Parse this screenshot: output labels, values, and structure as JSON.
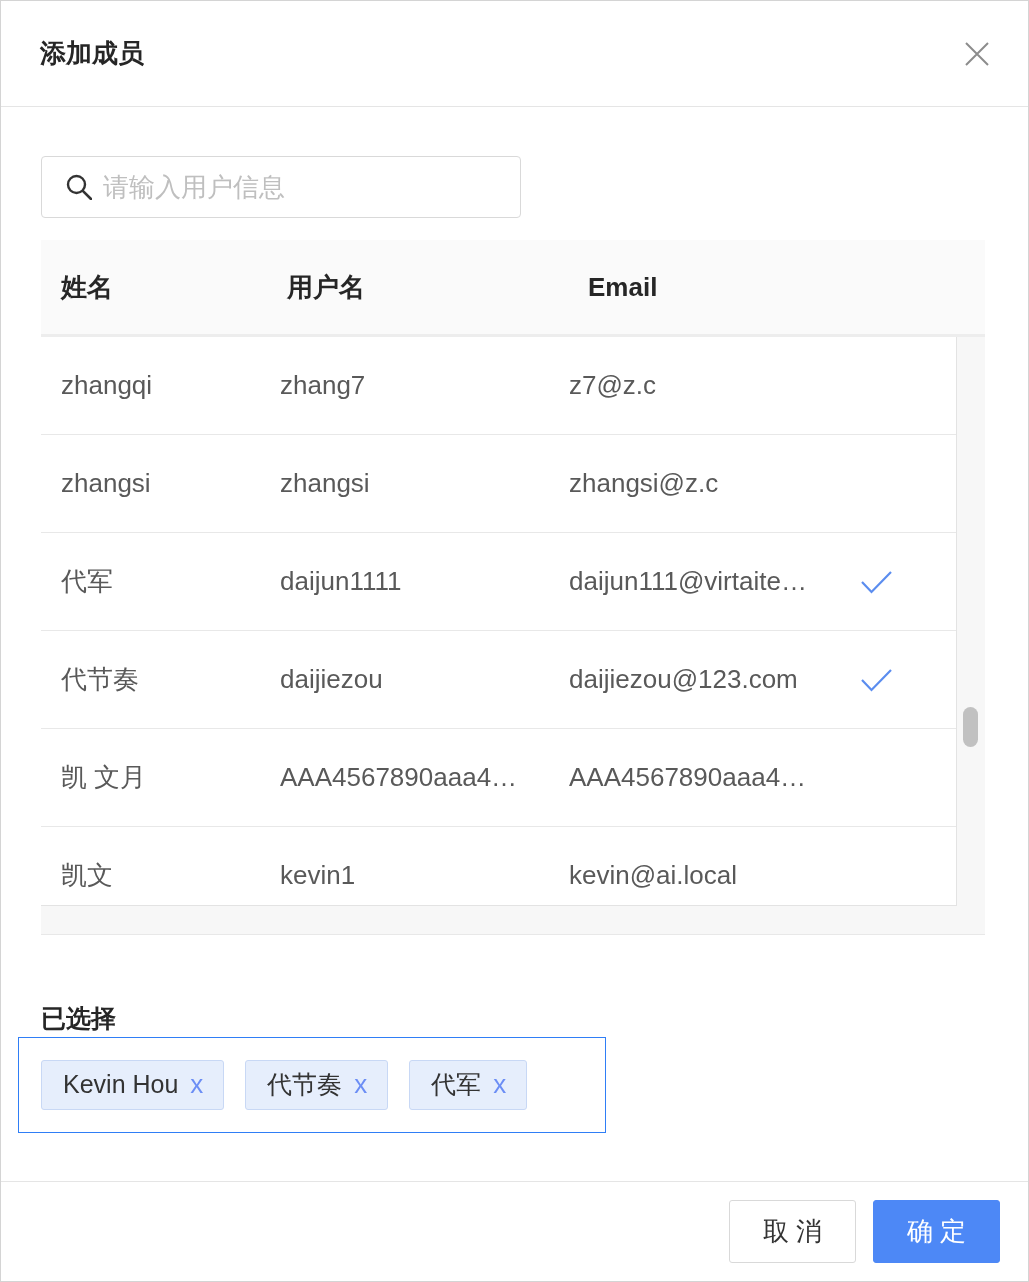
{
  "dialog": {
    "title": "添加成员"
  },
  "search": {
    "placeholder": "请输入用户信息"
  },
  "table": {
    "columns": [
      "姓名",
      "用户名",
      "Email"
    ],
    "rows": [
      {
        "name": "zhangqi",
        "username": "zhang7",
        "email": "z7@z.c",
        "selected": false
      },
      {
        "name": "zhangsi",
        "username": "zhangsi",
        "email": "zhangsi@z.c",
        "selected": false
      },
      {
        "name": "代军",
        "username": "daijun1111",
        "email": "daijun111@virtaite…",
        "selected": true
      },
      {
        "name": "代节奏",
        "username": "daijiezou",
        "email": "daijiezou@123.com",
        "selected": true
      },
      {
        "name": "凯 文月",
        "username": "AAA4567890aaa4…",
        "email": "AAA4567890aaa4…",
        "selected": false
      },
      {
        "name": "凯文",
        "username": "kevin1",
        "email": "kevin@ai.local",
        "selected": false
      }
    ]
  },
  "selected_section": {
    "label": "已选择",
    "tags": [
      {
        "label": "Kevin Hou",
        "remove": "x"
      },
      {
        "label": "代节奏",
        "remove": "x"
      },
      {
        "label": "代军",
        "remove": "x"
      }
    ]
  },
  "buttons": [
    {
      "label": "取 消",
      "kind": "default"
    },
    {
      "label": "确 定",
      "kind": "primary"
    }
  ]
}
